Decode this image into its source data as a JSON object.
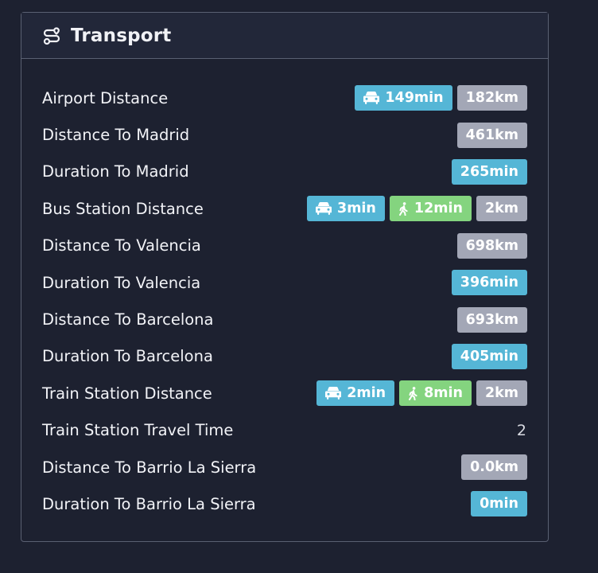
{
  "panel": {
    "title": "Transport",
    "title_icon": "route-icon"
  },
  "colors": {
    "background": "#1d2130",
    "header_background": "#222739",
    "border": "#5a6072",
    "car_badge": "#55b6d6",
    "walk_badge": "#84d47f",
    "time_badge": "#55b6d6",
    "distance_badge": "#a3a7b6"
  },
  "rows": [
    {
      "label": "Airport Distance",
      "car": "149min",
      "distance": "182km"
    },
    {
      "label": "Distance To Madrid",
      "distance": "461km"
    },
    {
      "label": "Duration To Madrid",
      "duration": "265min"
    },
    {
      "label": "Bus Station Distance",
      "car": "3min",
      "walk": "12min",
      "distance": "2km"
    },
    {
      "label": "Distance To Valencia",
      "distance": "698km"
    },
    {
      "label": "Duration To Valencia",
      "duration": "396min"
    },
    {
      "label": "Distance To Barcelona",
      "distance": "693km"
    },
    {
      "label": "Duration To Barcelona",
      "duration": "405min"
    },
    {
      "label": "Train Station Distance",
      "car": "2min",
      "walk": "8min",
      "distance": "2km"
    },
    {
      "label": "Train Station Travel Time",
      "value": "2"
    },
    {
      "label": "Distance To Barrio La Sierra",
      "distance": "0.0km"
    },
    {
      "label": "Duration To Barrio La Sierra",
      "duration": "0min"
    }
  ]
}
